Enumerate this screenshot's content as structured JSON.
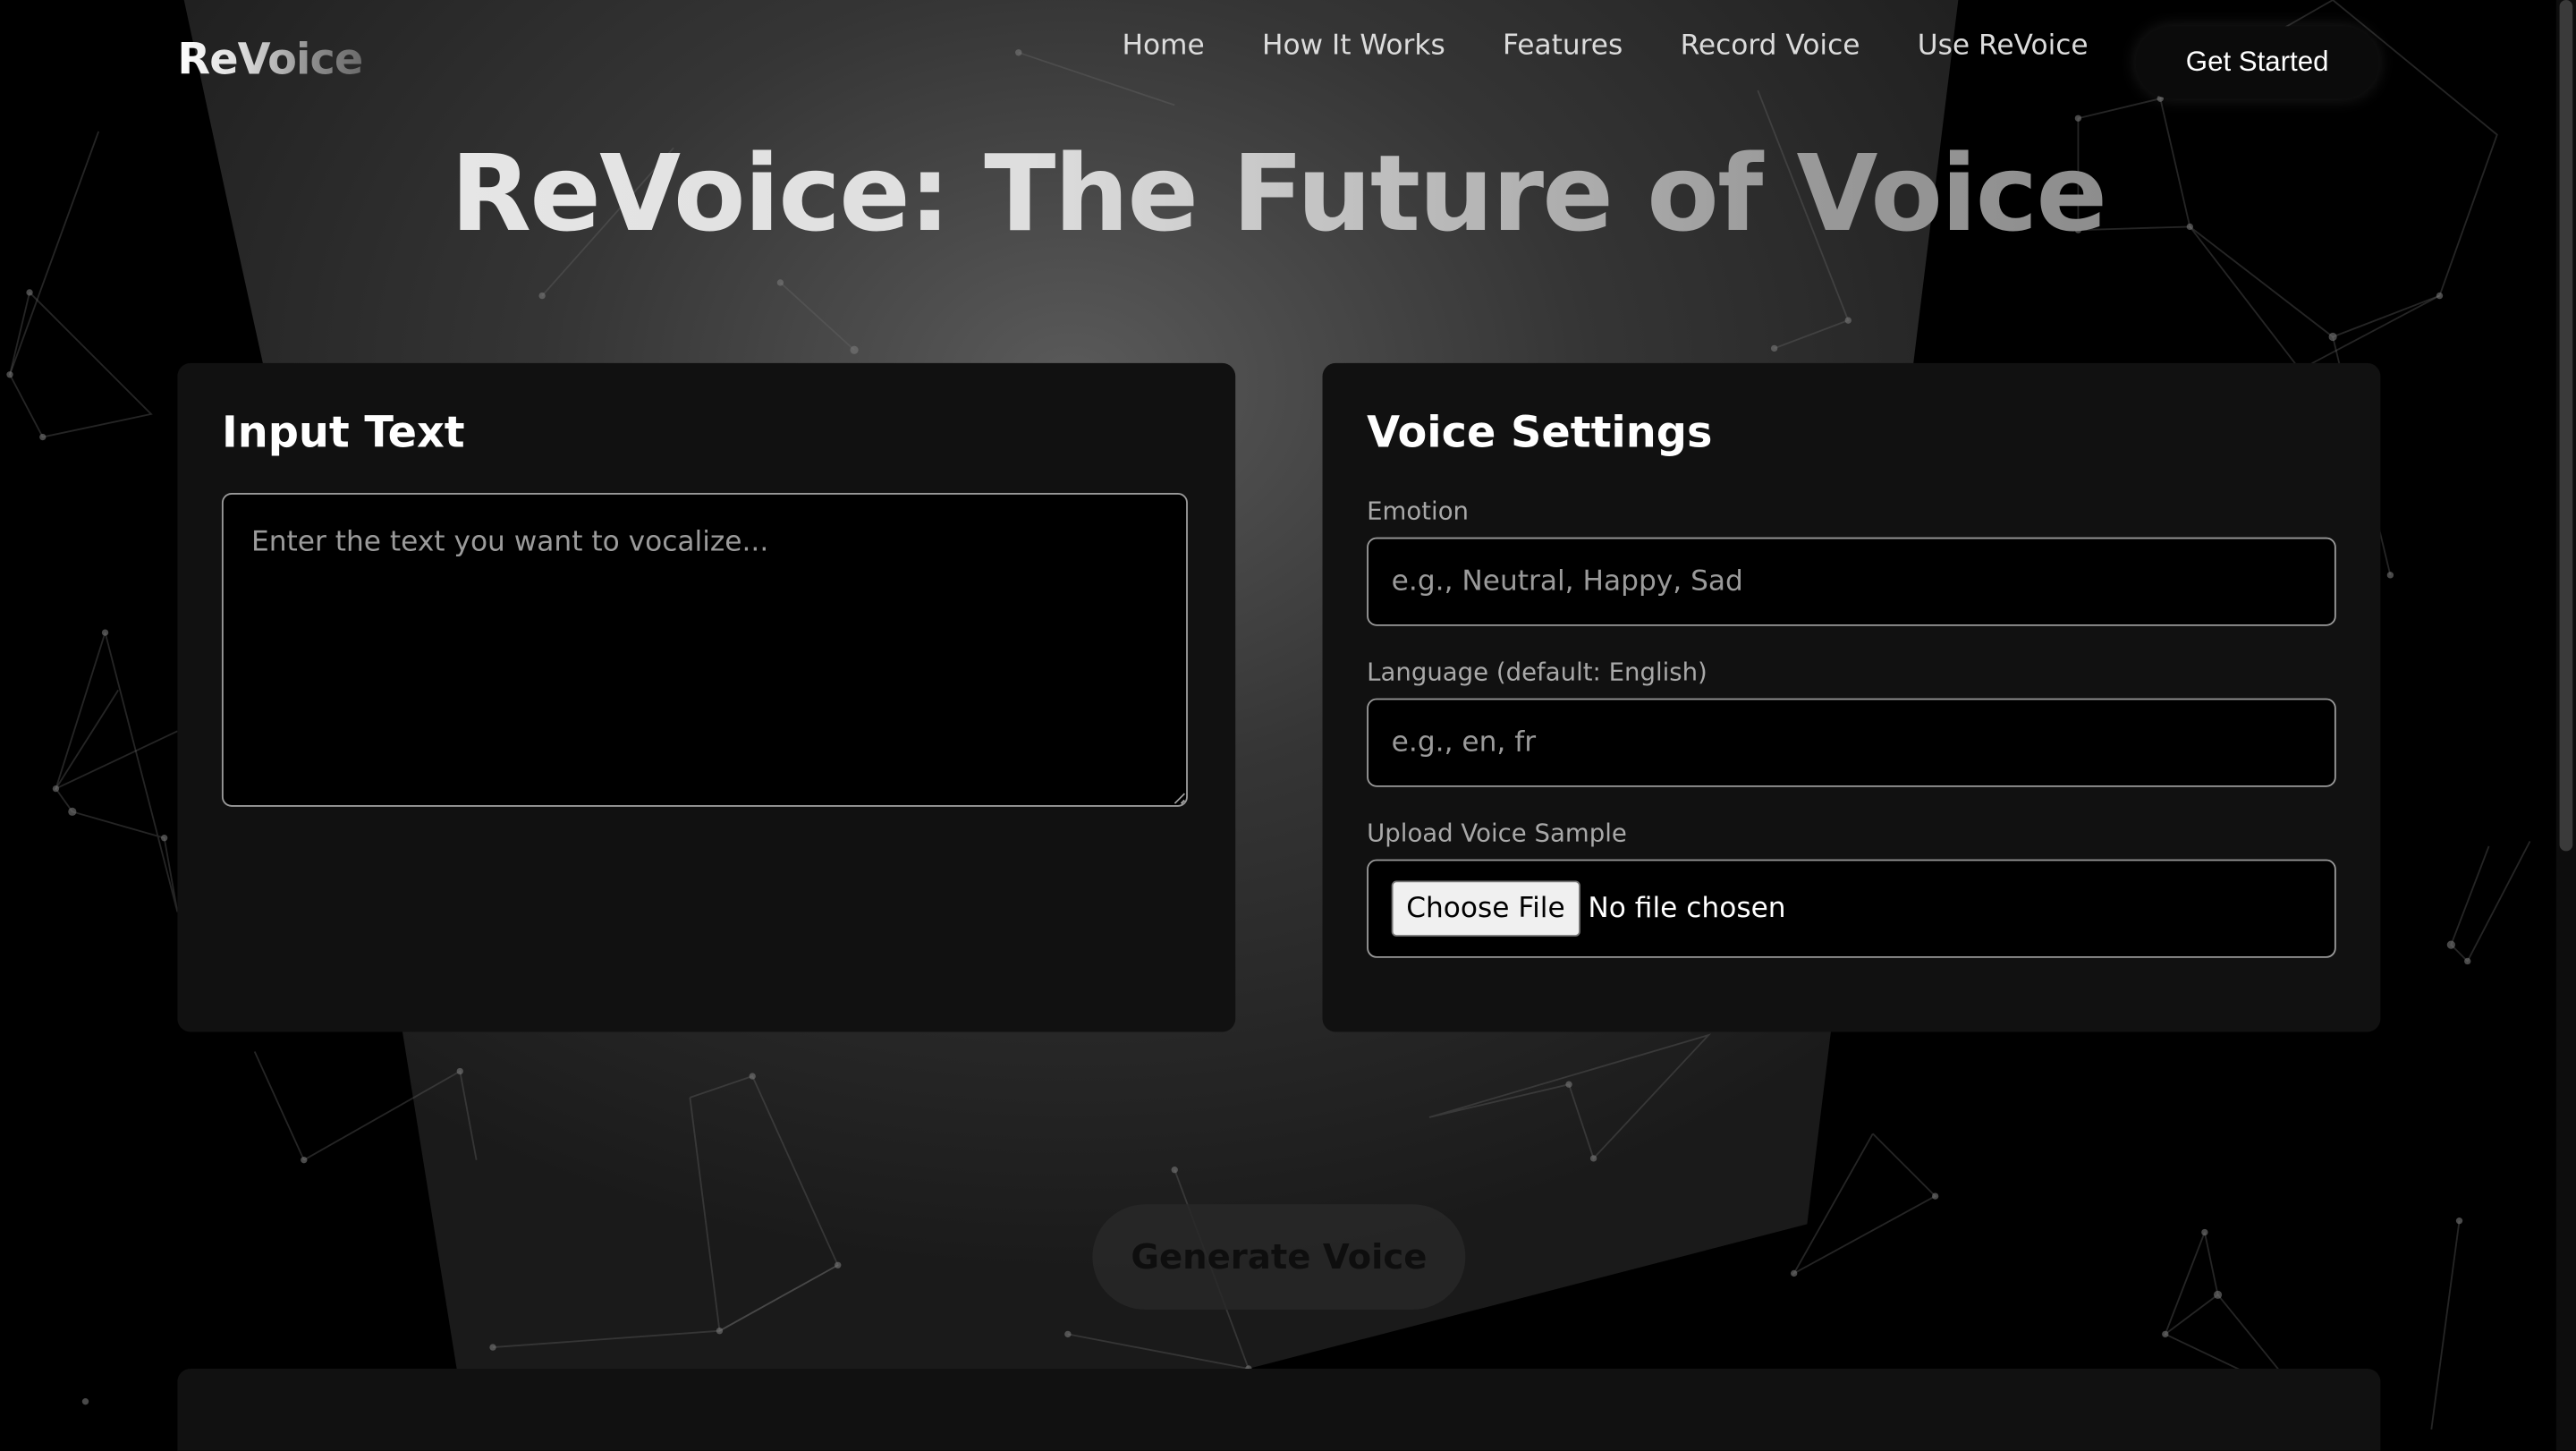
{
  "brand": {
    "logo": "ReVoice"
  },
  "nav": {
    "items": [
      "Home",
      "How It Works",
      "Features",
      "Record Voice",
      "Use ReVoice"
    ],
    "cta": "Get Started"
  },
  "hero": {
    "title": "ReVoice: The Future of Voice"
  },
  "input_panel": {
    "title": "Input Text",
    "textarea_placeholder": "Enter the text you want to vocalize..."
  },
  "settings_panel": {
    "title": "Voice Settings",
    "emotion_label": "Emotion",
    "emotion_placeholder": "e.g., Neutral, Happy, Sad",
    "language_label": "Language (default: English)",
    "language_placeholder": "e.g., en, fr",
    "upload_label": "Upload Voice Sample",
    "choose_file": "Choose File",
    "no_file": "No file chosen"
  },
  "actions": {
    "generate": "Generate Voice"
  }
}
